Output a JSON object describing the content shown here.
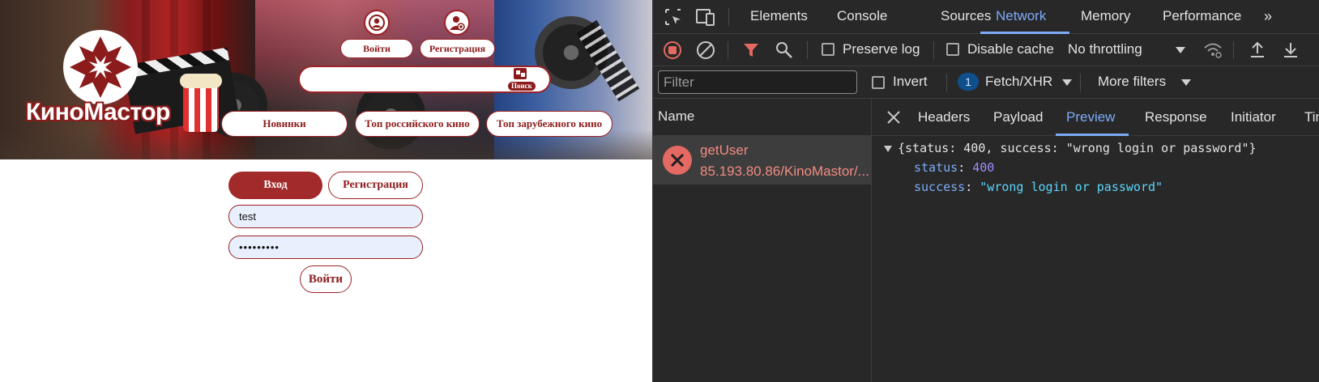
{
  "site": {
    "logo_text": "КиноМастор",
    "header": {
      "login_label": "Войти",
      "register_label": "Регистрация",
      "search_value": "",
      "search_button_label": "Поиск"
    },
    "nav": [
      {
        "label": "Новинки"
      },
      {
        "label": "Топ российского кино"
      },
      {
        "label": "Топ зарубежного кино"
      }
    ],
    "auth": {
      "tab_login": "Вход",
      "tab_register": "Регистрация",
      "login_value": "test",
      "password_value": "•••••••••",
      "submit_label": "Войти"
    },
    "colors": {
      "accent": "#9b2226",
      "accent_fill": "#a32a2a",
      "field_bg": "#e8f0fe"
    }
  },
  "devtools": {
    "tabs": [
      "Elements",
      "Console",
      "Sources",
      "Network",
      "Memory",
      "Performance"
    ],
    "active_tab": "Network",
    "toolbar": {
      "preserve_log": "Preserve log",
      "disable_cache": "Disable cache",
      "throttling": "No throttling"
    },
    "filter": {
      "placeholder": "Filter",
      "invert": "Invert",
      "type_count": "1",
      "type_label": "Fetch/XHR",
      "more_filters": "More filters"
    },
    "list": {
      "name_header": "Name",
      "requests": [
        {
          "name": "getUser",
          "url": "85.193.80.86/KinoMastor/...",
          "status": "error"
        }
      ]
    },
    "detail": {
      "tabs": [
        "Headers",
        "Payload",
        "Preview",
        "Response",
        "Initiator",
        "Tim"
      ],
      "active_tab": "Preview",
      "preview": {
        "summary": "{status: 400, success: \"wrong login or password\"}",
        "fields": [
          {
            "key": "status",
            "value": "400",
            "type": "number"
          },
          {
            "key": "success",
            "value": "\"wrong login or password\"",
            "type": "string"
          }
        ]
      }
    }
  }
}
